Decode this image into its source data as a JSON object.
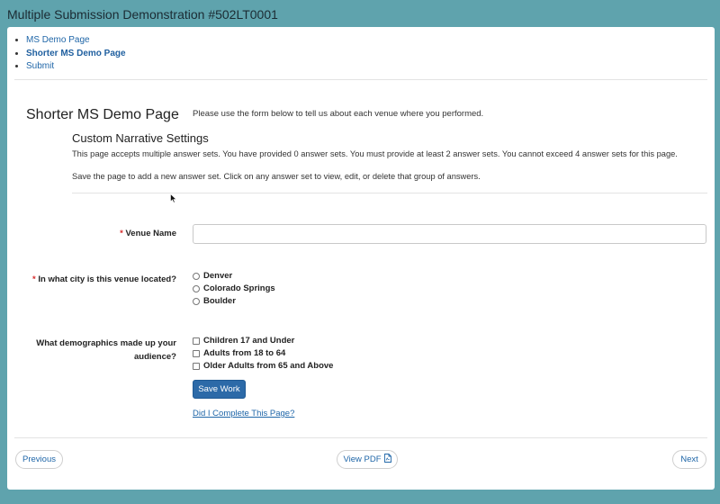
{
  "window": {
    "title": "Multiple Submission Demonstration #502LT0001"
  },
  "nav": {
    "items": [
      {
        "label": "MS Demo Page",
        "active": false
      },
      {
        "label": "Shorter MS Demo Page",
        "active": true
      },
      {
        "label": "Submit",
        "active": false
      }
    ]
  },
  "page": {
    "title": "Shorter MS Demo Page",
    "intro": "Please use the form below to tell us about each venue where you performed."
  },
  "section": {
    "title": "Custom Narrative Settings",
    "para1": "This page accepts multiple answer sets. You have provided 0 answer sets. You must provide at least 2 answer sets. You cannot exceed 4 answer sets for this page.",
    "para2": "Save the page to add a new answer set. Click on any answer set to view, edit, or delete that group of answers."
  },
  "form": {
    "required_mark": "*",
    "venue": {
      "label": "Venue Name",
      "value": ""
    },
    "city": {
      "label": "In what city is this venue located?",
      "options": [
        "Denver",
        "Colorado Springs",
        "Boulder"
      ]
    },
    "demographics": {
      "label_line1": "What demographics made up your",
      "label_line2": "audience?",
      "options": [
        "Children 17 and Under",
        "Adults from 18 to 64",
        "Older Adults from 65 and Above"
      ]
    },
    "save_label": "Save Work",
    "complete_link": "Did I Complete This Page?"
  },
  "footer": {
    "previous_label": "Previous",
    "pdf_label": "View PDF",
    "next_label": "Next"
  },
  "colors": {
    "background": "#5fa3ad",
    "primary": "#2c6aa8",
    "link": "#1f66a8",
    "required": "#d62b2b"
  },
  "icons": [
    "pdf-icon",
    "mouse-cursor-icon"
  ]
}
